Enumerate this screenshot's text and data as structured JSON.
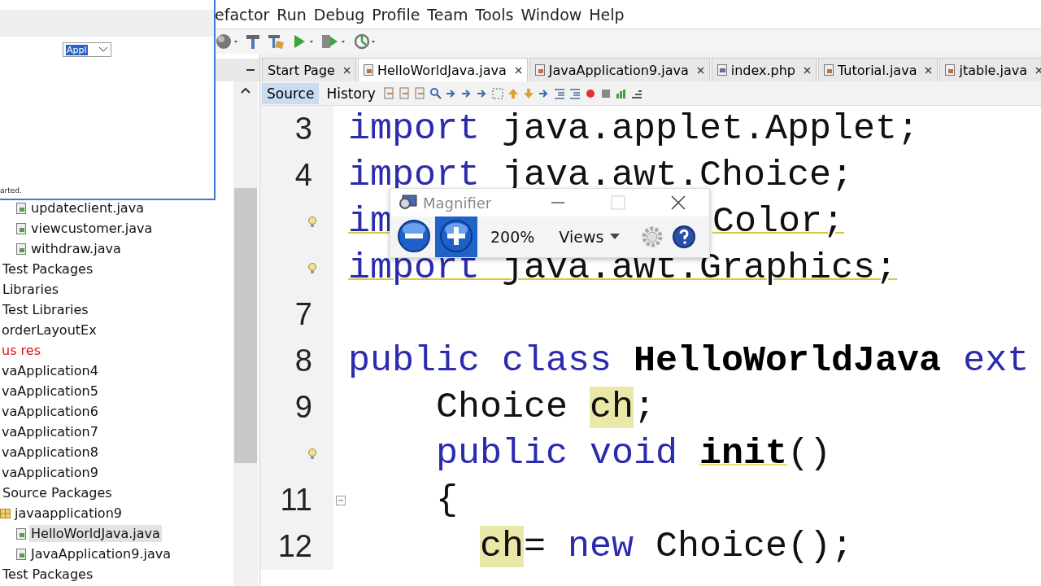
{
  "menu": [
    "efactor",
    "Run",
    "Debug",
    "Profile",
    "Team",
    "Tools",
    "Window",
    "Help"
  ],
  "project_tree": [
    {
      "children": [
        {
          "children": [
            {
              "children": [
                {
                  "label": "updateclient.java",
                  "kind": "file",
                  "selected": false
                },
                {
                  "label": "viewcustomer.java",
                  "kind": "file",
                  "selected": false
                },
                {
                  "label": "withdraw.java",
                  "kind": "file",
                  "selected": false
                }
              ]
            }
          ]
        },
        {
          "label": "Test Packages",
          "selected": false
        },
        {
          "label": "Libraries",
          "selected": false
        },
        {
          "label": "Test Libraries",
          "selected": false
        }
      ]
    },
    {
      "label": "orderLayoutEx",
      "error": false,
      "selected": false
    },
    {
      "label": "us res",
      "error": true,
      "selected": false
    },
    {
      "label": "vaApplication4",
      "error": false,
      "selected": false
    },
    {
      "label": "vaApplication5",
      "error": false,
      "selected": false
    },
    {
      "label": "vaApplication6",
      "error": false,
      "selected": false
    },
    {
      "label": "vaApplication7",
      "error": false,
      "selected": false
    },
    {
      "label": "vaApplication8",
      "error": false,
      "selected": false
    },
    {
      "label": "vaApplication9",
      "error": false,
      "selected": false,
      "children": [
        {
          "label": "Source Packages",
          "selected": false,
          "children": [
            {
              "label": "javaapplication9",
              "kind": "package",
              "selected": false,
              "children": [
                {
                  "label": "HelloWorldJava.java",
                  "kind": "file",
                  "selected": true
                },
                {
                  "label": "JavaApplication9.java",
                  "kind": "file",
                  "selected": false
                }
              ]
            }
          ]
        },
        {
          "label": "Test Packages",
          "selected": false
        }
      ]
    }
  ],
  "editor_tabs": [
    {
      "label": "Start Page",
      "kind": "page",
      "selected": false
    },
    {
      "label": "HelloWorldJava.java",
      "kind": "file",
      "selected": true
    },
    {
      "label": "JavaApplication9.java",
      "kind": "file",
      "selected": false
    },
    {
      "label": "index.php",
      "kind": "php",
      "selected": false
    },
    {
      "label": "Tutorial.java",
      "kind": "file",
      "selected": false
    },
    {
      "label": "jtable.java",
      "kind": "file",
      "selected": false
    }
  ],
  "editor_views": [
    {
      "label": "Source",
      "selected": true
    },
    {
      "label": "History",
      "selected": false
    }
  ],
  "code_lines": [
    {
      "number": "3",
      "kind": "top",
      "tokens": [
        {
          "text": "import",
          "kind": "keyword"
        },
        {
          "text": " java.applet.Applet;",
          "kind": "plain"
        }
      ]
    },
    {
      "number": "4",
      "kind": "top",
      "tokens": [
        {
          "text": "import",
          "kind": "keyword"
        },
        {
          "text": " java.awt.Choice;",
          "kind": "plain"
        }
      ]
    },
    {
      "kind": "top",
      "hint": true,
      "warning": true,
      "tokens": [
        {
          "text": "im",
          "kind": "keyword"
        },
        {
          "text": "Color;",
          "kind": "resumed"
        }
      ]
    },
    {
      "kind": "top",
      "hint": true,
      "warning": true,
      "tokens": [
        {
          "text": "import",
          "kind": "keyword"
        },
        {
          "text": " java.awt.Graphics;",
          "kind": "plain"
        }
      ]
    },
    {
      "number": "7",
      "kind": "top"
    },
    {
      "number": "8",
      "kind": "top",
      "tokens": [
        {
          "text": "public class ",
          "kind": "keyword"
        },
        {
          "text": "HelloWorldJava ",
          "kind": "bold"
        },
        {
          "text": "ext",
          "kind": "keyword"
        }
      ]
    },
    {
      "number": "9",
      "kind": "member",
      "tokens": [
        {
          "text": "Choice ",
          "kind": "plain"
        },
        {
          "text": "ch",
          "kind": "mark"
        },
        {
          "text": ";",
          "kind": "plain"
        }
      ]
    },
    {
      "kind": "member",
      "hint": true,
      "tokens": [
        {
          "text": "public void ",
          "kind": "keyword"
        },
        {
          "text": "init",
          "kind": "method"
        },
        {
          "text": "()",
          "kind": "plain"
        }
      ]
    },
    {
      "number": "11",
      "kind": "brace",
      "tokens": [
        {
          "text": "{",
          "kind": "plain"
        }
      ]
    },
    {
      "number": "12",
      "kind": "statement",
      "tokens": [
        {
          "text": "ch",
          "kind": "mark"
        },
        {
          "text": "= ",
          "kind": "plain"
        },
        {
          "text": "new",
          "kind": "keyword"
        },
        {
          "text": " Choice();",
          "kind": "plain"
        }
      ]
    }
  ],
  "applet_window": {
    "choice": {
      "value": "Appl"
    },
    "status": "arted."
  },
  "magnifier": {
    "title": "Magnifier",
    "zoom": "200%",
    "views": "Views",
    "buttons": [
      {
        "kind": "zoom-out",
        "highlighted": false
      },
      {
        "kind": "zoom-in",
        "highlighted": true
      }
    ]
  }
}
